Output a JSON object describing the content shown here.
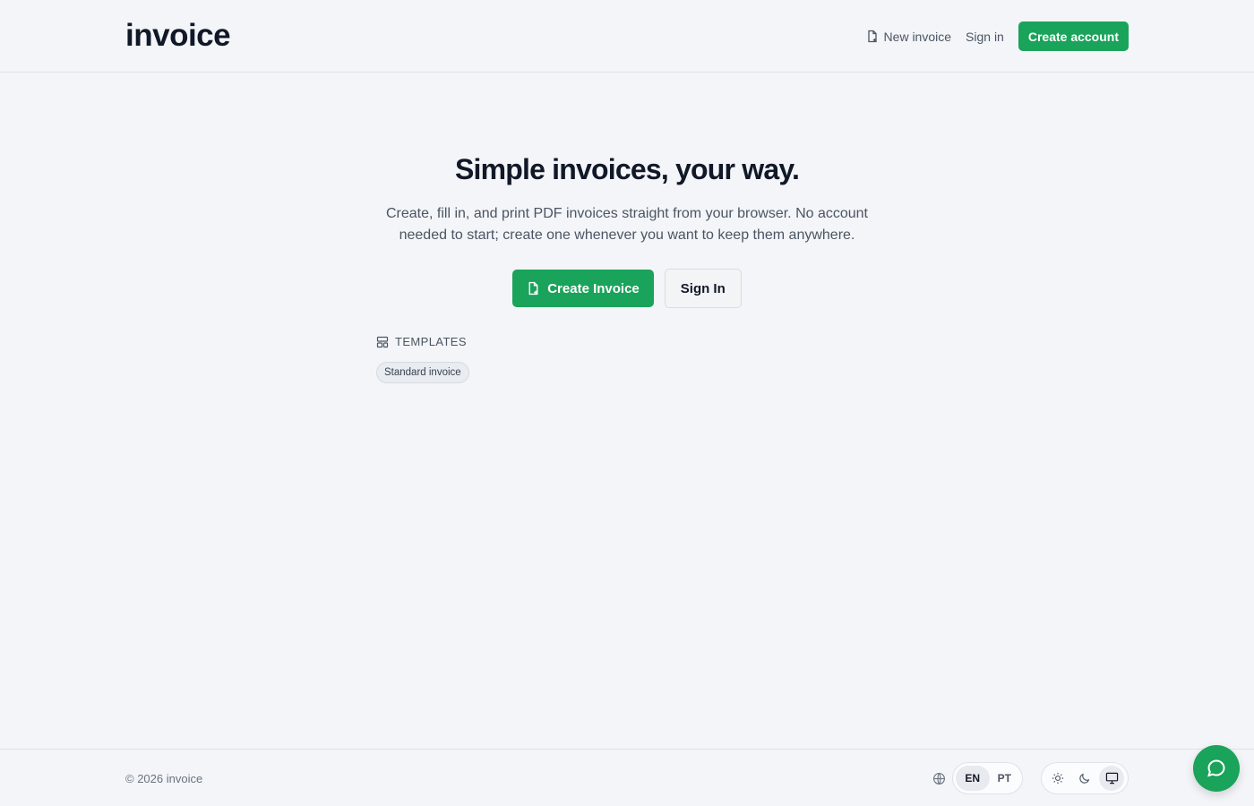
{
  "header": {
    "brand": "invoice",
    "nav": {
      "new_invoice_label": "New invoice",
      "sign_in_label": "Sign in",
      "create_account_label": "Create account"
    }
  },
  "hero": {
    "title": "Simple invoices, your way.",
    "subtitle": "Create, fill in, and print PDF invoices straight from your browser. No account needed to start; create one whenever you want to keep them anywhere.",
    "create_invoice_label": "Create Invoice",
    "sign_in_label": "Sign In"
  },
  "templates": {
    "heading": "TEMPLATES",
    "items": [
      "Standard invoice"
    ]
  },
  "footer": {
    "copyright": "© 2026 invoice",
    "languages": [
      "EN",
      "PT"
    ],
    "active_language": "EN",
    "theme_options": [
      "light",
      "dark",
      "system"
    ],
    "active_theme": "system"
  },
  "icons": {
    "new_invoice": "file-plus-icon",
    "templates": "layout-icon",
    "language": "globe-icon",
    "light": "sun-icon",
    "dark": "moon-icon",
    "system": "monitor-icon",
    "chat": "chat-bubble-icon"
  },
  "colors": {
    "accent": "#1aa35a",
    "background": "#f3f5f8"
  }
}
